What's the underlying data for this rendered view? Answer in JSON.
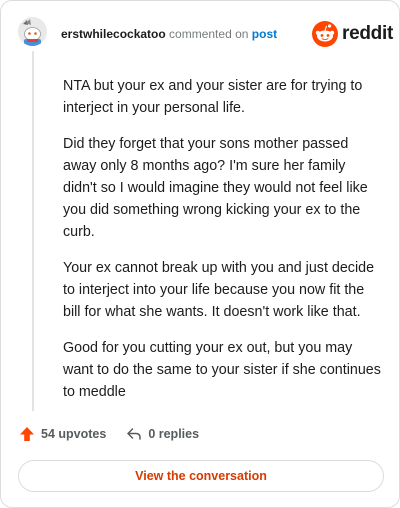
{
  "header": {
    "username": "erstwhilecockatoo",
    "action_text": "commented on",
    "post_link": "post"
  },
  "brand": {
    "wordmark": "reddit",
    "color": "#ff4500"
  },
  "comment": {
    "paragraphs": [
      "NTA but your ex and your sister are for trying to interject in your personal life.",
      "Did they forget that your sons mother passed away only 8 months ago? I'm sure her family didn't so I would imagine they would not feel like you did something wrong kicking your ex to the curb.",
      "Your ex cannot break up with you and just decide to interject into your life because you now fit the bill for what she wants. It doesn't work like that.",
      "Good for you cutting your ex out, but you may want to do the same to your sister if she continues to meddle"
    ]
  },
  "actions": {
    "upvotes": "54 upvotes",
    "replies": "0 replies"
  },
  "footer": {
    "view_label": "View the conversation"
  },
  "colors": {
    "accent": "#d93a00",
    "upvote": "#ff4500",
    "link": "#0079d3"
  },
  "icons": {
    "avatar": "snoo-avatar",
    "upvote": "upvote-arrow-icon",
    "reply": "reply-icon",
    "logo": "reddit-snoo-icon"
  }
}
